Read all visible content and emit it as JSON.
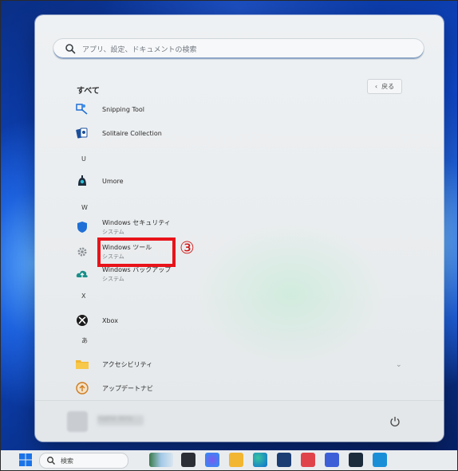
{
  "search": {
    "placeholder": "アプリ、設定、ドキュメントの検索"
  },
  "all_apps": {
    "title": "すべて",
    "back_label": "戻る"
  },
  "apps": [
    {
      "name": "Snipping Tool"
    },
    {
      "name": "Solitaire Collection"
    },
    {
      "name": "Umore"
    },
    {
      "name": "Windows セキュリティ",
      "subtitle": "システム"
    },
    {
      "name": "Windows ツール",
      "subtitle": "システム"
    },
    {
      "name": "Windows バックアップ",
      "subtitle": "システム"
    },
    {
      "name": "Xbox"
    },
    {
      "name": "アクセシビリティ"
    },
    {
      "name": "アップデートナビ"
    }
  ],
  "letters": [
    "U",
    "W",
    "X",
    "あ"
  ],
  "annotation": {
    "marker": "③",
    "color": "#e8131a"
  },
  "footer": {
    "username": "Sophie Veria"
  },
  "taskbar": {
    "search_label": "検索"
  },
  "colors": {
    "accent": "#0067c0",
    "highlight": "#e8131a"
  }
}
